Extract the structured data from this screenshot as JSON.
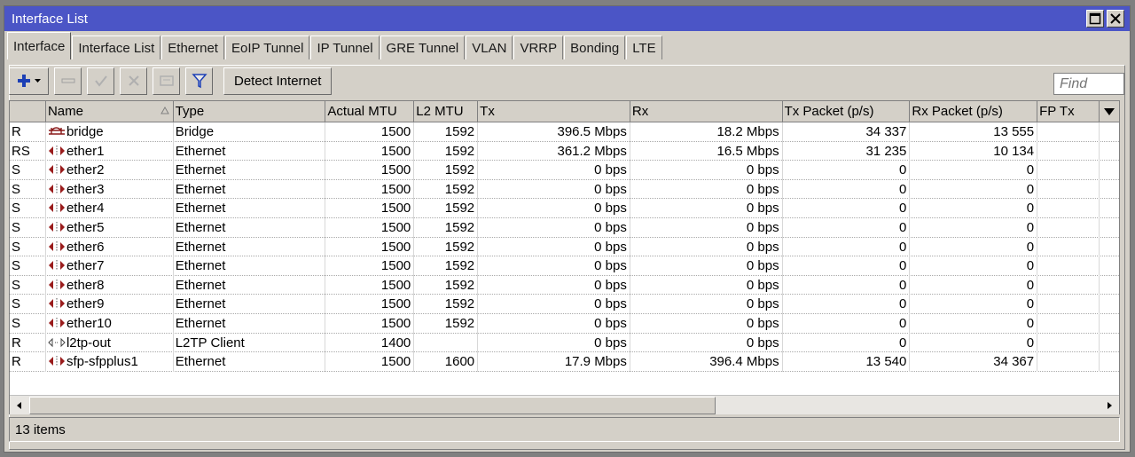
{
  "window": {
    "title": "Interface List"
  },
  "tabs": [
    "Interface",
    "Interface List",
    "Ethernet",
    "EoIP Tunnel",
    "IP Tunnel",
    "GRE Tunnel",
    "VLAN",
    "VRRP",
    "Bonding",
    "LTE"
  ],
  "toolbar": {
    "buttons": [
      "add-icon",
      "remove-icon",
      "enable-icon",
      "disable-icon",
      "comment-icon",
      "filter-icon"
    ],
    "detect_label": "Detect Internet"
  },
  "search": {
    "placeholder": "Find"
  },
  "table": {
    "columns": [
      "",
      "Name",
      "Type",
      "Actual MTU",
      "L2 MTU",
      "Tx",
      "Rx",
      "Tx Packet (p/s)",
      "Rx Packet (p/s)",
      "FP Tx",
      ""
    ],
    "rows": [
      {
        "flags": "R",
        "icon": "bridge-icon",
        "name": "bridge",
        "type": "Bridge",
        "mtu": "1500",
        "l2mtu": "1592",
        "tx": "396.5 Mbps",
        "rx": "18.2 Mbps",
        "txp": "34 337",
        "rxp": "13 555"
      },
      {
        "flags": "RS",
        "icon": "ethernet-icon",
        "name": "ether1",
        "type": "Ethernet",
        "mtu": "1500",
        "l2mtu": "1592",
        "tx": "361.2 Mbps",
        "rx": "16.5 Mbps",
        "txp": "31 235",
        "rxp": "10 134"
      },
      {
        "flags": "S",
        "icon": "ethernet-icon",
        "name": "ether2",
        "type": "Ethernet",
        "mtu": "1500",
        "l2mtu": "1592",
        "tx": "0 bps",
        "rx": "0 bps",
        "txp": "0",
        "rxp": "0"
      },
      {
        "flags": "S",
        "icon": "ethernet-icon",
        "name": "ether3",
        "type": "Ethernet",
        "mtu": "1500",
        "l2mtu": "1592",
        "tx": "0 bps",
        "rx": "0 bps",
        "txp": "0",
        "rxp": "0"
      },
      {
        "flags": "S",
        "icon": "ethernet-icon",
        "name": "ether4",
        "type": "Ethernet",
        "mtu": "1500",
        "l2mtu": "1592",
        "tx": "0 bps",
        "rx": "0 bps",
        "txp": "0",
        "rxp": "0"
      },
      {
        "flags": "S",
        "icon": "ethernet-icon",
        "name": "ether5",
        "type": "Ethernet",
        "mtu": "1500",
        "l2mtu": "1592",
        "tx": "0 bps",
        "rx": "0 bps",
        "txp": "0",
        "rxp": "0"
      },
      {
        "flags": "S",
        "icon": "ethernet-icon",
        "name": "ether6",
        "type": "Ethernet",
        "mtu": "1500",
        "l2mtu": "1592",
        "tx": "0 bps",
        "rx": "0 bps",
        "txp": "0",
        "rxp": "0"
      },
      {
        "flags": "S",
        "icon": "ethernet-icon",
        "name": "ether7",
        "type": "Ethernet",
        "mtu": "1500",
        "l2mtu": "1592",
        "tx": "0 bps",
        "rx": "0 bps",
        "txp": "0",
        "rxp": "0"
      },
      {
        "flags": "S",
        "icon": "ethernet-icon",
        "name": "ether8",
        "type": "Ethernet",
        "mtu": "1500",
        "l2mtu": "1592",
        "tx": "0 bps",
        "rx": "0 bps",
        "txp": "0",
        "rxp": "0"
      },
      {
        "flags": "S",
        "icon": "ethernet-icon",
        "name": "ether9",
        "type": "Ethernet",
        "mtu": "1500",
        "l2mtu": "1592",
        "tx": "0 bps",
        "rx": "0 bps",
        "txp": "0",
        "rxp": "0"
      },
      {
        "flags": "S",
        "icon": "ethernet-icon",
        "name": "ether10",
        "type": "Ethernet",
        "mtu": "1500",
        "l2mtu": "1592",
        "tx": "0 bps",
        "rx": "0 bps",
        "txp": "0",
        "rxp": "0"
      },
      {
        "flags": "R",
        "icon": "tunnel-icon",
        "name": "l2tp-out",
        "type": "L2TP Client",
        "mtu": "1400",
        "l2mtu": "",
        "tx": "0 bps",
        "rx": "0 bps",
        "txp": "0",
        "rxp": "0"
      },
      {
        "flags": "R",
        "icon": "ethernet-icon",
        "name": "sfp-sfpplus1",
        "type": "Ethernet",
        "mtu": "1500",
        "l2mtu": "1600",
        "tx": "17.9 Mbps",
        "rx": "396.4 Mbps",
        "txp": "13 540",
        "rxp": "34 367"
      }
    ]
  },
  "status": {
    "items_text": "13 items"
  }
}
